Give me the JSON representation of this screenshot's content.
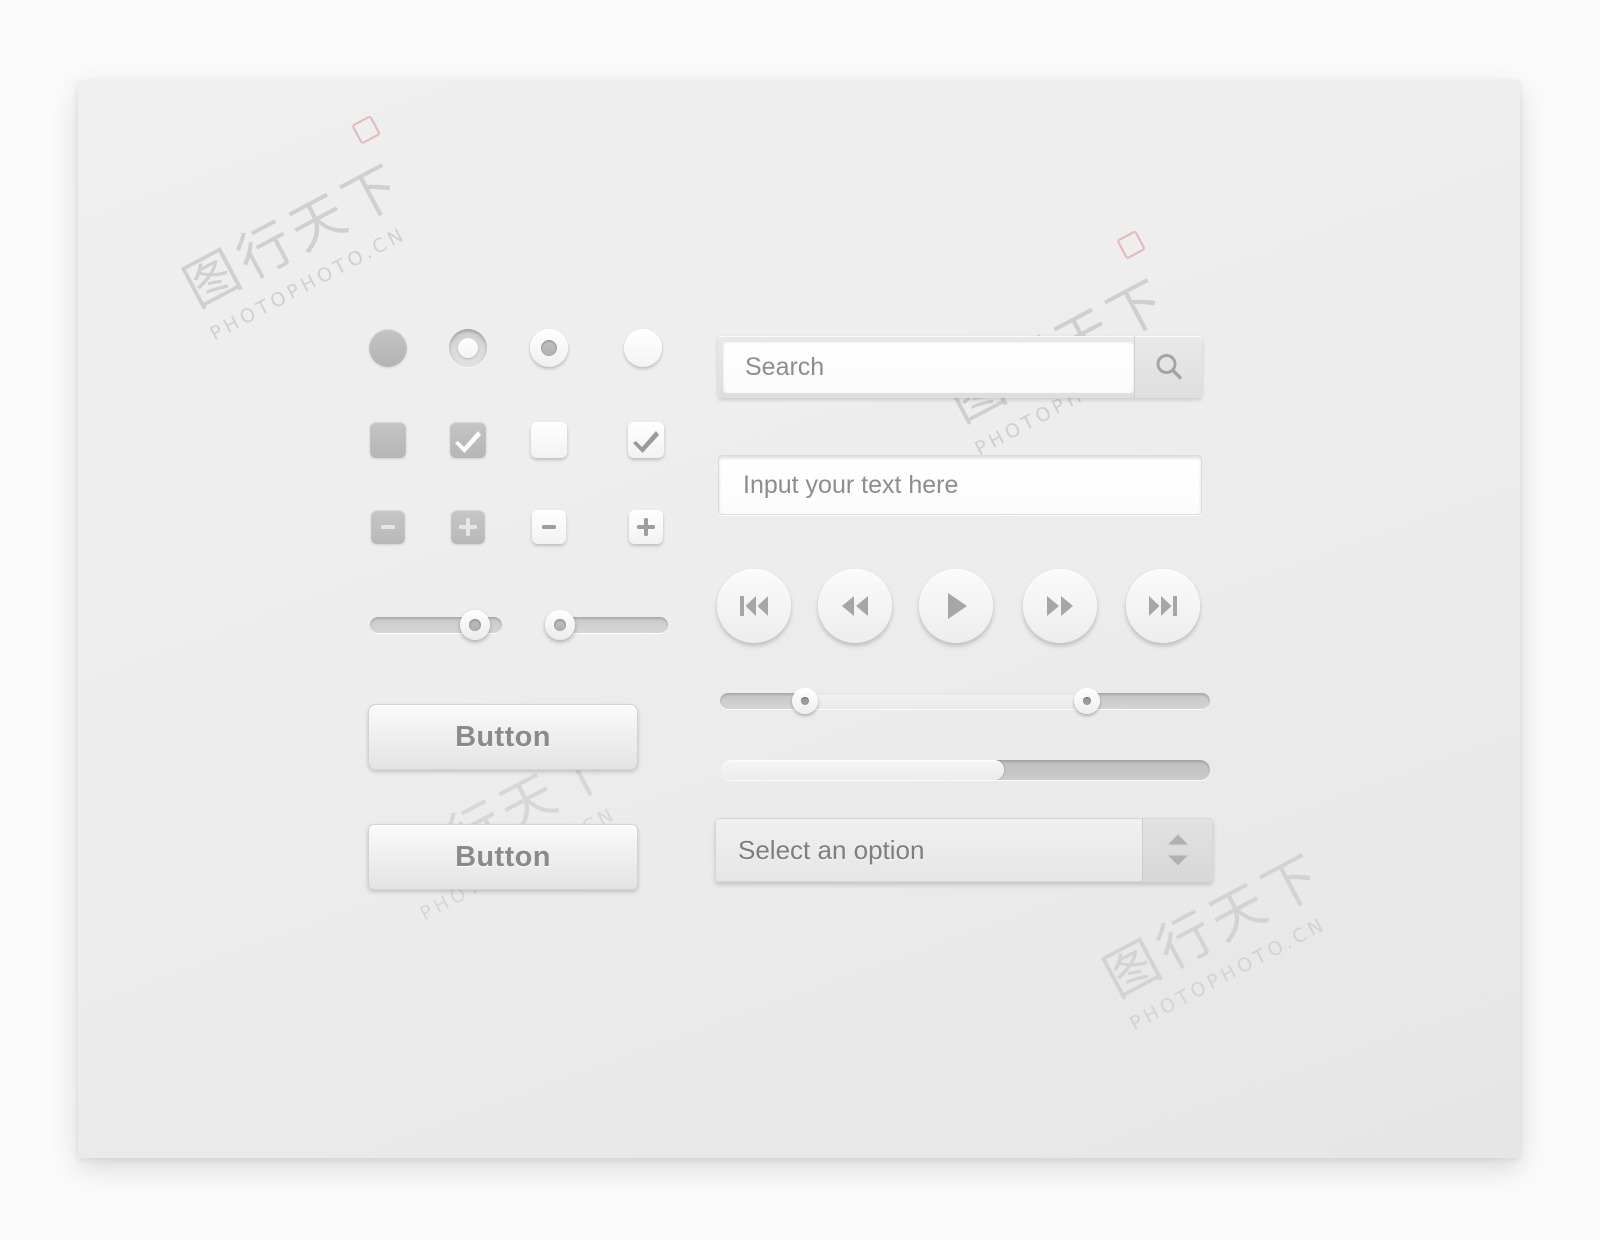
{
  "page": {
    "background_color": "#fafafa",
    "card_color": "#ededed"
  },
  "controls": {
    "radios": [
      {
        "name": "radio-filled-dark",
        "state": "selected-flat"
      },
      {
        "name": "radio-inset-light",
        "state": "unselected-inset"
      },
      {
        "name": "radio-selected-dot",
        "state": "selected"
      },
      {
        "name": "radio-empty-light",
        "state": "unselected"
      }
    ],
    "checkboxes": [
      {
        "name": "checkbox-gray-empty",
        "checked": false,
        "style": "gray"
      },
      {
        "name": "checkbox-gray-checked",
        "checked": true,
        "style": "gray"
      },
      {
        "name": "checkbox-white-empty",
        "checked": false,
        "style": "white"
      },
      {
        "name": "checkbox-white-checked",
        "checked": true,
        "style": "white"
      }
    ],
    "steppers": [
      {
        "name": "minus-gray",
        "glyph": "minus",
        "style": "gray"
      },
      {
        "name": "plus-gray",
        "glyph": "plus",
        "style": "gray"
      },
      {
        "name": "minus-white",
        "glyph": "minus",
        "style": "white"
      },
      {
        "name": "plus-white",
        "glyph": "plus",
        "style": "white"
      }
    ],
    "sliders": [
      {
        "name": "slider-left",
        "value_percent": 80
      },
      {
        "name": "slider-right",
        "value_percent": 10
      }
    ],
    "buttons": [
      {
        "name": "button-primary",
        "label": "Button"
      },
      {
        "name": "button-secondary",
        "label": "Button"
      }
    ]
  },
  "search": {
    "placeholder": "Search",
    "icon": "search-icon",
    "button_name": "search-button"
  },
  "text_input": {
    "placeholder": "Input your text here"
  },
  "media_player": {
    "buttons": [
      {
        "name": "skip-back-button",
        "icon": "skip-backward-icon"
      },
      {
        "name": "rewind-button",
        "icon": "rewind-icon"
      },
      {
        "name": "play-button",
        "icon": "play-icon"
      },
      {
        "name": "fast-forward-button",
        "icon": "fast-forward-icon"
      },
      {
        "name": "skip-forward-button",
        "icon": "skip-forward-icon"
      }
    ]
  },
  "range_slider": {
    "name": "dual-range-slider",
    "low_percent": 17,
    "high_percent": 75
  },
  "progress_bar": {
    "name": "progress-bar",
    "value_percent": 58
  },
  "select": {
    "value": "Select an option",
    "stepper_up_icon": "caret-up-icon",
    "stepper_down_icon": "caret-down-icon"
  },
  "watermarks": {
    "cjk": "图行天下",
    "latin": "PHOTOPHOTO.CN"
  }
}
